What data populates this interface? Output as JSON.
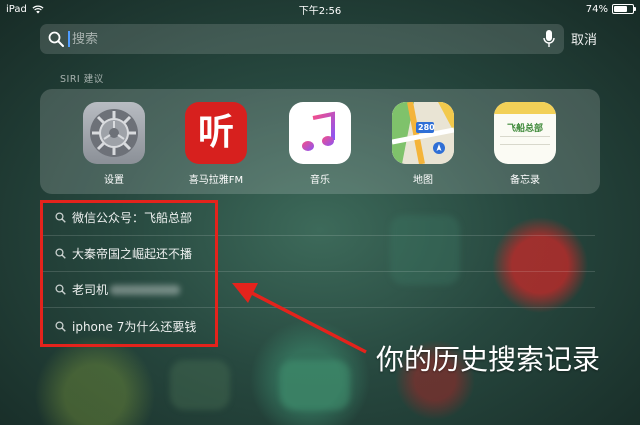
{
  "status_bar": {
    "device": "iPad",
    "time": "下午2:56",
    "battery": "74%",
    "battery_level": 0.74
  },
  "search": {
    "placeholder": "搜索",
    "cancel_label": "取消"
  },
  "siri": {
    "section_label": "SIRI 建议",
    "apps": [
      {
        "label": "设置",
        "icon": "gear-icon"
      },
      {
        "label": "喜马拉雅FM",
        "icon": "ximalaya-icon",
        "icon_text": "听"
      },
      {
        "label": "音乐",
        "icon": "music-note-icon"
      },
      {
        "label": "地图",
        "icon": "map-icon",
        "icon_text": "280"
      },
      {
        "label": "备忘录",
        "icon": "notes-icon",
        "icon_text": "飞船总部"
      }
    ]
  },
  "history": [
    {
      "text": "微信公众号：飞船总部"
    },
    {
      "text": "大秦帝国之崛起还不播"
    },
    {
      "text": "老司机",
      "blurred": true
    },
    {
      "text": "iphone 7为什么还要钱"
    }
  ],
  "annotation": {
    "caption": "你的历史搜索记录",
    "color": "#e4231c"
  }
}
